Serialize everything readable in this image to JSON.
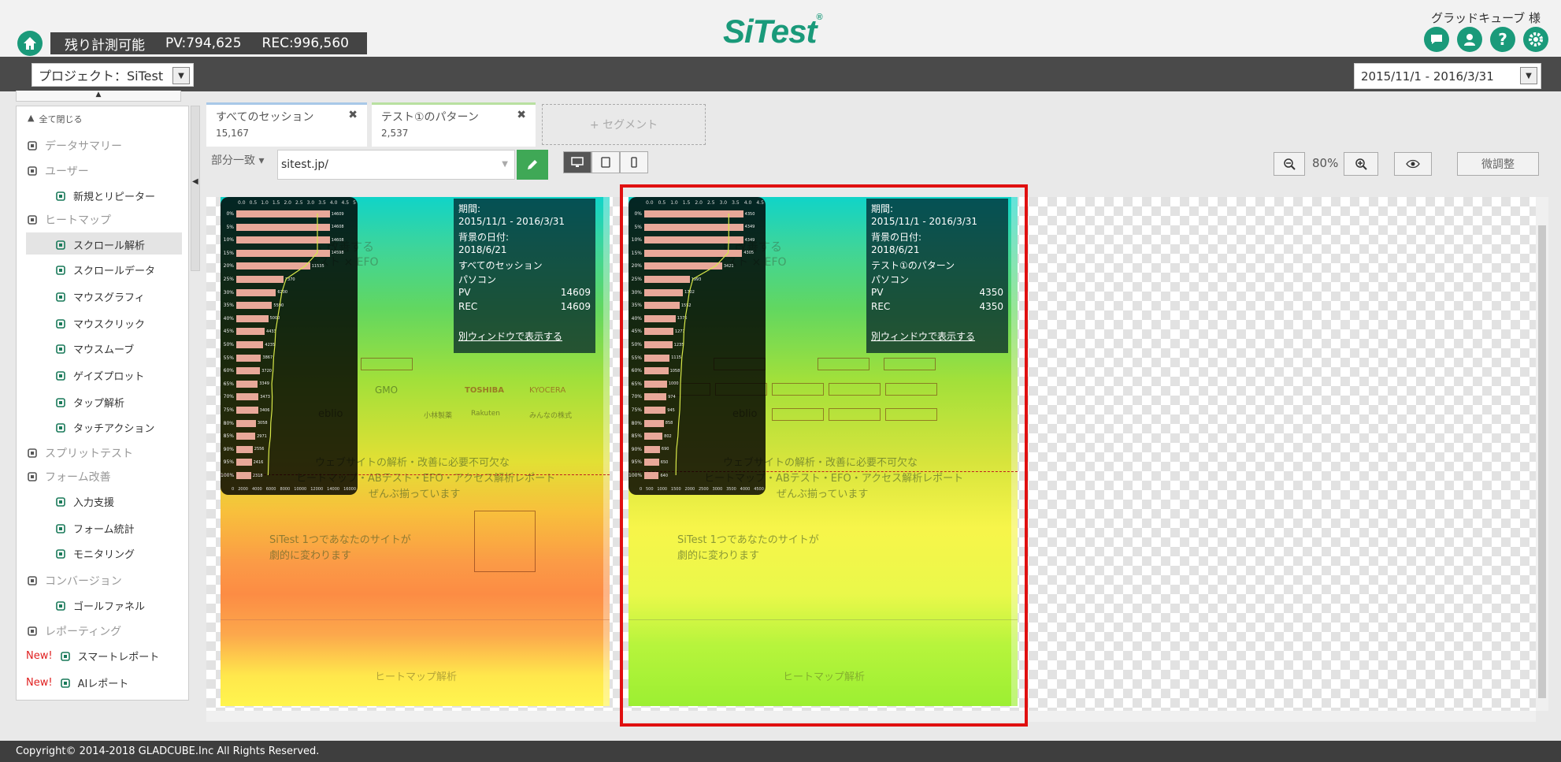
{
  "header": {
    "quota_label": "残り計測可能",
    "pv": "PV:794,625",
    "rec": "REC:996,560",
    "logo_text": "SiTest",
    "logo_mark": "®",
    "user": "グラッドキューブ 様"
  },
  "toolbar": {
    "project": "プロジェクト：SiTest",
    "date_range": "2015/11/1 - 2016/3/31"
  },
  "sidebar": {
    "collapse_all": "全て閉じる",
    "items": [
      {
        "label": "データサマリー",
        "icon": "clipboard-icon",
        "type": "category"
      },
      {
        "label": "ユーザー",
        "icon": "person-icon",
        "type": "category"
      },
      {
        "label": "新規とリピーター",
        "icon": "user-add-icon",
        "type": "sub"
      },
      {
        "label": "ヒートマップ",
        "icon": "heatmap-icon",
        "type": "category"
      },
      {
        "label": "スクロール解析",
        "icon": "scroll-icon",
        "type": "sub",
        "active": true
      },
      {
        "label": "スクロールデータ",
        "icon": "scroll-data-icon",
        "type": "sub"
      },
      {
        "label": "マウスグラフィ",
        "icon": "mouse-graph-icon",
        "type": "sub"
      },
      {
        "label": "マウスクリック",
        "icon": "mouse-click-icon",
        "type": "sub"
      },
      {
        "label": "マウスムーブ",
        "icon": "mouse-move-icon",
        "type": "sub"
      },
      {
        "label": "ゲイズプロット",
        "icon": "gaze-icon",
        "type": "sub"
      },
      {
        "label": "タップ解析",
        "icon": "tap-icon",
        "type": "sub"
      },
      {
        "label": "タッチアクション",
        "icon": "touch-icon",
        "type": "sub"
      },
      {
        "label": "スプリットテスト",
        "icon": "toggle-icon",
        "type": "category"
      },
      {
        "label": "フォーム改善",
        "icon": "form-icon",
        "type": "category"
      },
      {
        "label": "入力支援",
        "icon": "input-assist-icon",
        "type": "sub"
      },
      {
        "label": "フォーム統計",
        "icon": "bar-chart-icon",
        "type": "sub"
      },
      {
        "label": "モニタリング",
        "icon": "video-icon",
        "type": "sub"
      },
      {
        "label": "コンバージョン",
        "icon": "handshake-icon",
        "type": "category"
      },
      {
        "label": "ゴールファネル",
        "icon": "flag-icon",
        "type": "sub"
      },
      {
        "label": "レポーティング",
        "icon": "report-icon",
        "type": "category"
      },
      {
        "label": "スマートレポート",
        "icon": "smart-report-icon",
        "type": "sub",
        "badge": "New!"
      },
      {
        "label": "AIレポート",
        "icon": "ai-icon",
        "type": "sub",
        "badge": "New!"
      }
    ]
  },
  "segments": [
    {
      "name": "すべてのセッション",
      "count": "15,167",
      "color": "#a8c8e8"
    },
    {
      "name": "テスト①のパターン",
      "count": "2,537",
      "color": "#b8e0a0"
    }
  ],
  "segment_add": "+ セグメント",
  "filter": {
    "match": "部分一致",
    "url": "sitest.jp/"
  },
  "zoom": {
    "level": "80%",
    "fine_tune": "微調整"
  },
  "panels": [
    {
      "period_label": "期間:",
      "period": "2015/11/1 - 2016/3/31",
      "bg_date_label": "背景の日付:",
      "bg_date": "2018/6/21",
      "segment": "すべてのセッション",
      "device": "パソコン",
      "pv_label": "PV",
      "pv": "14609",
      "rec_label": "REC",
      "rec": "14609",
      "link": "別ウィンドウで表示する",
      "x_ticks_top": [
        "0.0",
        "0.5",
        "1.0",
        "1.5",
        "2.0",
        "2.5",
        "3.0",
        "3.5",
        "4.0",
        "4.5",
        "5"
      ],
      "x_ticks_bottom": [
        "0",
        "2000",
        "4000",
        "6000",
        "8000",
        "10000",
        "12000",
        "14000",
        "16000"
      ],
      "rows": [
        {
          "pct": "0%",
          "v": 14609
        },
        {
          "pct": "5%",
          "v": 14608
        },
        {
          "pct": "10%",
          "v": 14608
        },
        {
          "pct": "15%",
          "v": 14598
        },
        {
          "pct": "20%",
          "v": 11535
        },
        {
          "pct": "25%",
          "v": 7370
        },
        {
          "pct": "30%",
          "v": 6200
        },
        {
          "pct": "35%",
          "v": 5590
        },
        {
          "pct": "40%",
          "v": 5000
        },
        {
          "pct": "45%",
          "v": 4433
        },
        {
          "pct": "50%",
          "v": 4235
        },
        {
          "pct": "55%",
          "v": 3867
        },
        {
          "pct": "60%",
          "v": 3720
        },
        {
          "pct": "65%",
          "v": 3349
        },
        {
          "pct": "70%",
          "v": 3473
        },
        {
          "pct": "75%",
          "v": 3406
        },
        {
          "pct": "80%",
          "v": 3058
        },
        {
          "pct": "85%",
          "v": 2971
        },
        {
          "pct": "90%",
          "v": 2556
        },
        {
          "pct": "95%",
          "v": 2416
        },
        {
          "pct": "100%",
          "v": 2318
        }
      ],
      "x_max": 16000
    },
    {
      "period_label": "期間:",
      "period": "2015/11/1 - 2016/3/31",
      "bg_date_label": "背景の日付:",
      "bg_date": "2018/6/21",
      "segment": "テスト①のパターン",
      "device": "パソコン",
      "pv_label": "PV",
      "pv": "4350",
      "rec_label": "REC",
      "rec": "4350",
      "link": "別ウィンドウで表示する",
      "x_ticks_top": [
        "0.0",
        "0.5",
        "1.0",
        "1.5",
        "2.0",
        "2.5",
        "3.0",
        "3.5",
        "4.0",
        "4.5"
      ],
      "x_ticks_bottom": [
        "0",
        "500",
        "1000",
        "1500",
        "2000",
        "2500",
        "3000",
        "3500",
        "4000",
        "4500"
      ],
      "rows": [
        {
          "pct": "0%",
          "v": 4350
        },
        {
          "pct": "5%",
          "v": 4349
        },
        {
          "pct": "10%",
          "v": 4349
        },
        {
          "pct": "15%",
          "v": 4305
        },
        {
          "pct": "20%",
          "v": 3421
        },
        {
          "pct": "25%",
          "v": 1993
        },
        {
          "pct": "30%",
          "v": 1702
        },
        {
          "pct": "35%",
          "v": 1552
        },
        {
          "pct": "40%",
          "v": 1376
        },
        {
          "pct": "45%",
          "v": 1277
        },
        {
          "pct": "50%",
          "v": 1235
        },
        {
          "pct": "55%",
          "v": 1115
        },
        {
          "pct": "60%",
          "v": 1058
        },
        {
          "pct": "65%",
          "v": 1000
        },
        {
          "pct": "70%",
          "v": 974
        },
        {
          "pct": "75%",
          "v": 945
        },
        {
          "pct": "80%",
          "v": 858
        },
        {
          "pct": "85%",
          "v": 802
        },
        {
          "pct": "90%",
          "v": 690
        },
        {
          "pct": "95%",
          "v": 650
        },
        {
          "pct": "100%",
          "v": 640
        }
      ],
      "x_max": 4500
    }
  ],
  "page_text": {
    "headline1": "に改善する",
    "headline2": "テスト × EFO",
    "section1": "ウェブサイトの解析・改善に必要不可欠な",
    "section1b": "ヒートマップ・ABテスト・EFO・アクセス解析レポート",
    "section1c": "ぜんぶ揃っています",
    "section2a": "SiTest 1つであなたのサイトが",
    "section2b": "劇的に変わります",
    "footer_heading": "ヒートマップ解析",
    "brands": [
      "TOSHIBA",
      "KYOCERA",
      "GMO",
      "eblio",
      "小林製薬",
      "Rakuten",
      "みんなの株式"
    ]
  },
  "footer": "Copyright© 2014-2018 GLADCUBE.Inc All Rights Reserved."
}
